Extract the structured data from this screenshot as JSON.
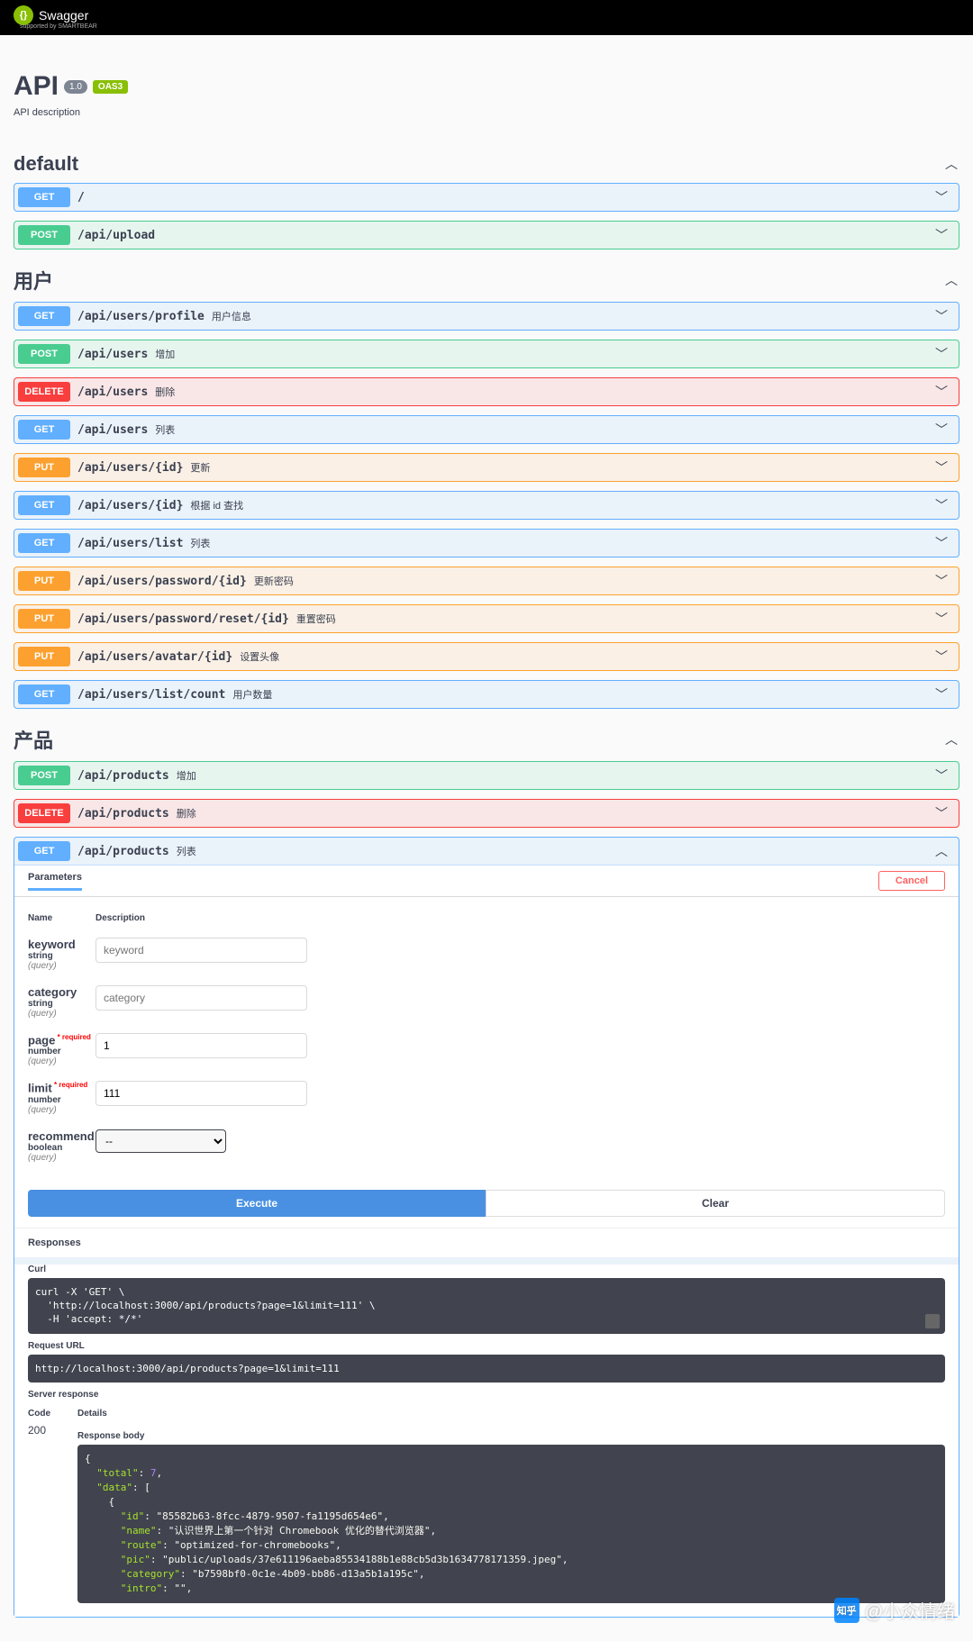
{
  "topbar": {
    "logo_text": "Swagger",
    "logo_byline": "supported by SMARTBEAR"
  },
  "header": {
    "title": "API",
    "version_badge": "1.0",
    "oas_badge": "OAS3",
    "description": "API description"
  },
  "tags": {
    "default": {
      "name": "default",
      "ops": [
        {
          "method": "GET",
          "path": "/",
          "summary": ""
        },
        {
          "method": "POST",
          "path": "/api/upload",
          "summary": ""
        }
      ]
    },
    "users": {
      "name": "用户",
      "ops": [
        {
          "method": "GET",
          "path": "/api/users/profile",
          "summary": "用户信息"
        },
        {
          "method": "POST",
          "path": "/api/users",
          "summary": "增加"
        },
        {
          "method": "DELETE",
          "path": "/api/users",
          "summary": "删除"
        },
        {
          "method": "GET",
          "path": "/api/users",
          "summary": "列表"
        },
        {
          "method": "PUT",
          "path": "/api/users/{id}",
          "summary": "更新"
        },
        {
          "method": "GET",
          "path": "/api/users/{id}",
          "summary": "根据 id 查找"
        },
        {
          "method": "GET",
          "path": "/api/users/list",
          "summary": "列表"
        },
        {
          "method": "PUT",
          "path": "/api/users/password/{id}",
          "summary": "更新密码"
        },
        {
          "method": "PUT",
          "path": "/api/users/password/reset/{id}",
          "summary": "重置密码"
        },
        {
          "method": "PUT",
          "path": "/api/users/avatar/{id}",
          "summary": "设置头像"
        },
        {
          "method": "GET",
          "path": "/api/users/list/count",
          "summary": "用户数量"
        }
      ]
    },
    "products": {
      "name": "产品",
      "ops": [
        {
          "method": "POST",
          "path": "/api/products",
          "summary": "增加"
        },
        {
          "method": "DELETE",
          "path": "/api/products",
          "summary": "删除"
        },
        {
          "method": "GET",
          "path": "/api/products",
          "summary": "列表",
          "expanded": true
        }
      ]
    }
  },
  "expanded_op": {
    "parameters_label": "Parameters",
    "cancel_label": "Cancel",
    "col_name": "Name",
    "col_desc": "Description",
    "required_label": "required",
    "params": [
      {
        "name": "keyword",
        "type": "string",
        "in": "(query)",
        "required": false,
        "placeholder": "keyword",
        "value": ""
      },
      {
        "name": "category",
        "type": "string",
        "in": "(query)",
        "required": false,
        "placeholder": "category",
        "value": ""
      },
      {
        "name": "page",
        "type": "number",
        "in": "(query)",
        "required": true,
        "placeholder": "",
        "value": "1"
      },
      {
        "name": "limit",
        "type": "number",
        "in": "(query)",
        "required": true,
        "placeholder": "",
        "value": "111"
      },
      {
        "name": "recommend",
        "type": "boolean",
        "in": "(query)",
        "required": false,
        "select_value": "--"
      }
    ],
    "execute_label": "Execute",
    "clear_label": "Clear",
    "responses_label": "Responses",
    "curl_label": "Curl",
    "curl_code": "curl -X 'GET' \\\n  'http://localhost:3000/api/products?page=1&limit=111' \\\n  -H 'accept: */*'",
    "request_url_label": "Request URL",
    "request_url": "http://localhost:3000/api/products?page=1&limit=111",
    "server_response_label": "Server response",
    "resp_code_label": "Code",
    "resp_details_label": "Details",
    "resp_code": "200",
    "resp_body_label": "Response body",
    "resp_json": {
      "total": 7,
      "data_item": {
        "id": "85582b63-8fcc-4879-9507-fa1195d654e6",
        "name": "认识世界上第一个针对 Chromebook 优化的替代浏览器",
        "route": "optimized-for-chromebooks",
        "pic": "public/uploads/37e611196aeba85534188b1e88cb5d3b1634778171359.jpeg",
        "category": "b7598bf0-0c1e-4b09-bb86-d13a5b1a195c",
        "intro": ""
      }
    }
  },
  "watermark": {
    "label": "知乎",
    "handle": "@小众情绪"
  }
}
